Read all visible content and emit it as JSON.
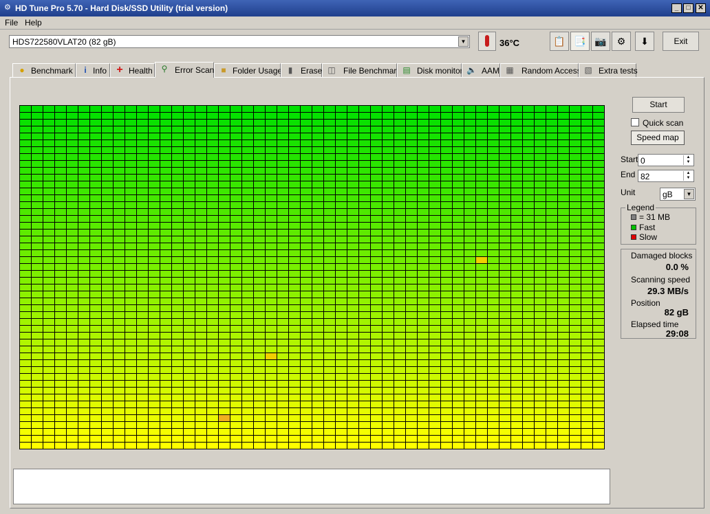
{
  "window": {
    "title": "HD Tune Pro 5.70 - Hard Disk/SSD Utility (trial version)"
  },
  "menu": [
    {
      "label": "File"
    },
    {
      "label": "Help"
    }
  ],
  "toolbar": {
    "drive": "HDS722580VLAT20 (82 gB)",
    "temperature": "36°C",
    "exit_label": "Exit"
  },
  "tabs": [
    {
      "label": "Benchmark",
      "icon": "lightbulb-icon"
    },
    {
      "label": "Info",
      "icon": "info-icon"
    },
    {
      "label": "Health",
      "icon": "health-cross-icon"
    },
    {
      "label": "Error Scan",
      "icon": "magnifier-icon"
    },
    {
      "label": "Folder Usage",
      "icon": "folder-icon"
    },
    {
      "label": "Erase",
      "icon": "trash-icon"
    },
    {
      "label": "File Benchmark",
      "icon": "file-benchmark-icon"
    },
    {
      "label": "Disk monitor",
      "icon": "chart-icon"
    },
    {
      "label": "AAM",
      "icon": "speaker-icon"
    },
    {
      "label": "Random Access",
      "icon": "random-access-icon"
    },
    {
      "label": "Extra tests",
      "icon": "extra-tests-icon"
    }
  ],
  "active_tab": "Error Scan",
  "side": {
    "start_button": "Start",
    "quick_scan_label": "Quick scan",
    "quick_scan_checked": false,
    "speed_map_label": "Speed map",
    "start_label": "Start",
    "start_value": "0",
    "end_label": "End",
    "end_value": "82",
    "unit_label": "Unit",
    "unit_value": "gB"
  },
  "legend": {
    "title": "Legend",
    "items": [
      {
        "label": "= 31 MB",
        "color": "#808080"
      },
      {
        "label": "Fast",
        "color": "#00c000"
      },
      {
        "label": "Slow",
        "color": "#e00000"
      }
    ]
  },
  "stats": {
    "damaged_label": "Damaged blocks",
    "damaged_value": "0.0 %",
    "speed_label": "Scanning speed",
    "speed_value": "29.3 MB/s",
    "position_label": "Position",
    "position_value": "82 gB",
    "elapsed_label": "Elapsed time",
    "elapsed_value": "29:08"
  },
  "scan_grid": {
    "columns": 50,
    "rows": 50,
    "gradient_top_color": "#00e000",
    "gradient_bottom_color": "#ffff00",
    "highlight_color": "#f0d000",
    "highlight2_color": "#f0b020",
    "highlights": [
      {
        "row": 22,
        "col": 39,
        "shade": "yellow"
      },
      {
        "row": 36,
        "col": 21,
        "shade": "yellow"
      },
      {
        "row": 45,
        "col": 17,
        "shade": "orange"
      }
    ]
  }
}
